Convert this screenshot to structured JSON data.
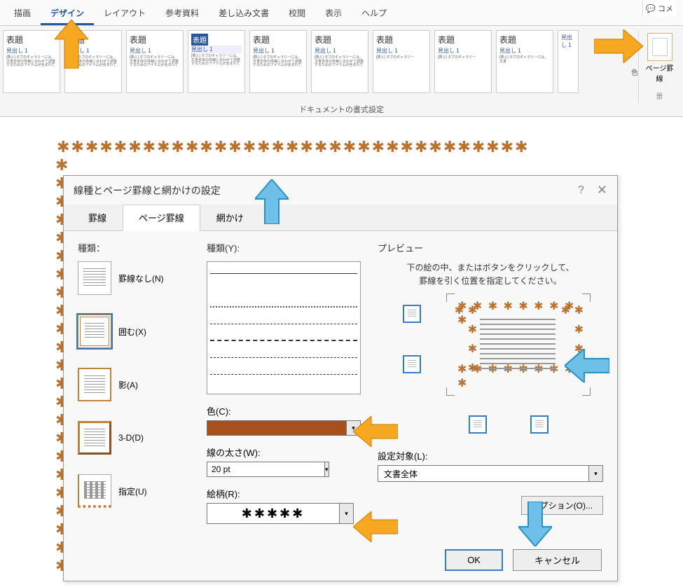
{
  "ribbon": {
    "tabs": [
      "描画",
      "デザイン",
      "レイアウト",
      "参考資料",
      "差し込み文書",
      "校閲",
      "表示",
      "ヘルプ"
    ],
    "active_tab": "デザイン",
    "style_title": "表題",
    "style_heading": "見出し 1",
    "group_label": "ドキュメントの書式設定",
    "page_border_label": "ページ罫線",
    "color_label": "色",
    "bg_label": "景",
    "comment_label": "コメ"
  },
  "dialog": {
    "title": "線種とページ罫線と網かけの設定",
    "tabs": {
      "borders": "罫線",
      "page_borders": "ページ罫線",
      "shading": "網かけ"
    },
    "setting": {
      "label": "種類：",
      "none": "罫線なし(N)",
      "box": "囲む(X)",
      "shadow": "影(A)",
      "threed": "3-D(D)",
      "custom": "指定(U)"
    },
    "style": {
      "label": "種類(Y):",
      "color_label": "色(C):",
      "color_value": "#a8501c",
      "width_label": "線の太さ(W):",
      "width_value": "20 pt",
      "art_label": "絵柄(R):",
      "art_value": "✱✱✱✱✱"
    },
    "preview": {
      "label": "プレビュー",
      "hint1": "下の絵の中、またはボタンをクリックして、",
      "hint2": "罫線を引く位置を指定してください。",
      "apply_label": "設定対象(L):",
      "apply_value": "文書全体",
      "options_label": "オプション(O)..."
    },
    "buttons": {
      "ok": "OK",
      "cancel": "キャンセル"
    }
  }
}
